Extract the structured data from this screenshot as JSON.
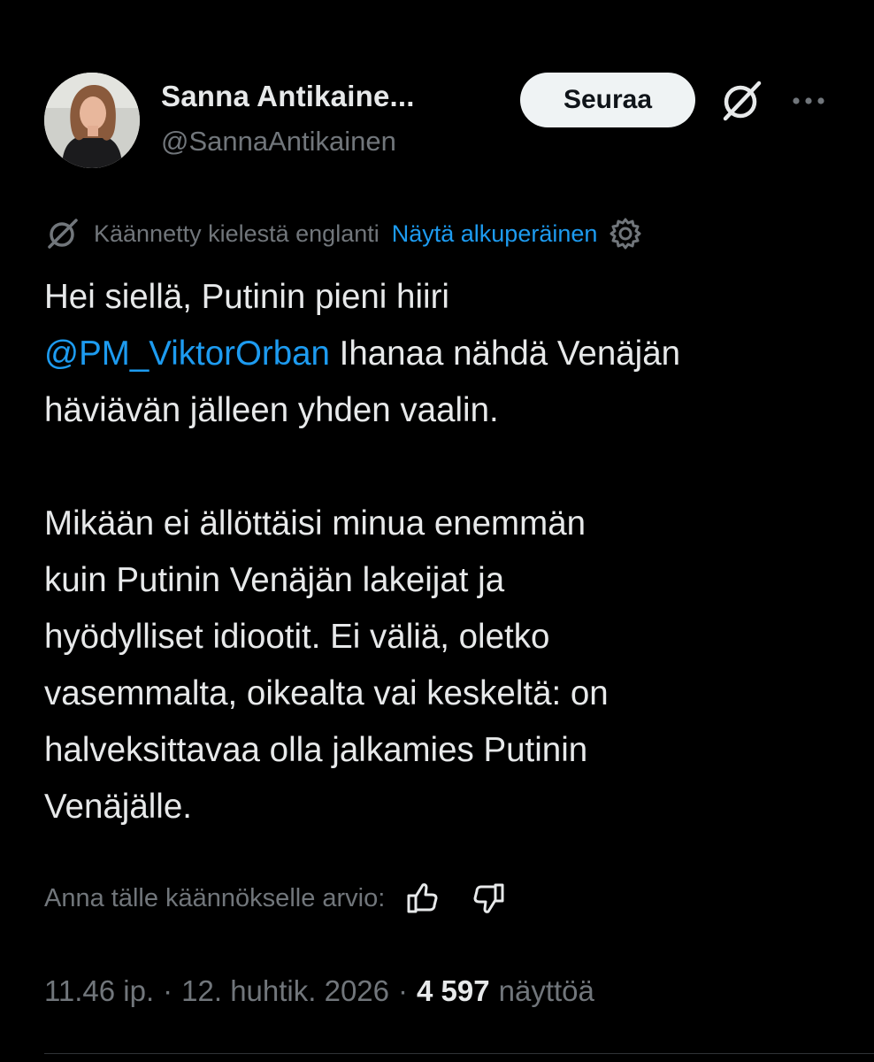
{
  "author": {
    "display_name": "Sanna Antikaine...",
    "handle": "@SannaAntikainen"
  },
  "actions": {
    "follow_label": "Seuraa",
    "grok_icon": "grok-icon",
    "more_icon": "more-icon"
  },
  "translation": {
    "translated_from": "Käännetty kielestä englanti",
    "show_original": "Näytä alkuperäinen"
  },
  "tweet": {
    "line1": "Hei siellä, Putinin pieni hiiri\n",
    "mention": "@PM_ViktorOrban",
    "rest": " Ihanaa nähdä Venäjän\nhäviävän jälleen yhden vaalin.\n\nMikään ei ällöttäisi minua enemmän\nkuin Putinin Venäjän lakeijat ja\nhyödylliset idiootit. Ei väliä, oletko\nvasemmalta, oikealta vai keskeltä: on\nhalveksittavaa olla jalkamies Putinin\nVenäjälle."
  },
  "rating": {
    "label": "Anna tälle käännökselle arvio:"
  },
  "meta": {
    "time": "11.46 ip.",
    "separator": "·",
    "date": "12. huhtik. 2026",
    "views_count": "4 597",
    "views_label": "näyttöä"
  },
  "colors": {
    "background": "#000000",
    "text": "#e7e9ea",
    "muted": "#71767b",
    "link": "#1d9bf0",
    "follow_bg": "#eff3f4"
  }
}
